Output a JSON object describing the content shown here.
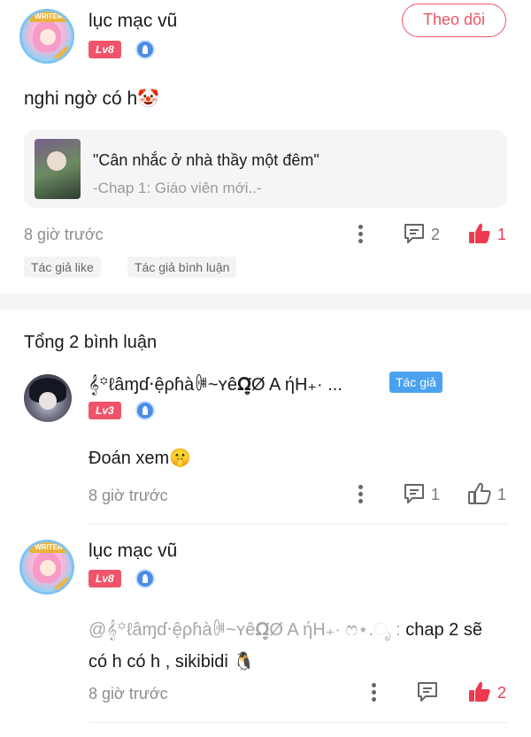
{
  "post": {
    "author": {
      "name": "lục mạc vũ",
      "level": "Lv8",
      "avatar_banner": "WRITER"
    },
    "follow_label": "Theo dõi",
    "text": "nghi ngờ có h",
    "text_emoji": "🤡",
    "reference": {
      "title": "\"Cân nhắc ở nhà thầy một đêm\"",
      "subtitle": "-Chap 1: Giáo viên mới..-"
    },
    "time": "8 giờ trước",
    "comment_count": "2",
    "like_count": "1",
    "tags": [
      "Tác giả like",
      "Tác giả bình luận"
    ],
    "colors": {
      "accent": "#ee3a50",
      "level_badge": "#f0546b",
      "author_tag": "#4aa2ee"
    }
  },
  "comments_header": {
    "total": "Tổng 2 bình luận"
  },
  "comments": [
    {
      "author": "𝄞꙳ℓâɱɗ‧ệρɦàꍲ~ʏê𝛀̤̥̣̈Ø A ήH₊· ...",
      "level": "Lv3",
      "author_tag": "Tác giả",
      "text": "Đoán xem",
      "text_emoji": "🤫",
      "time": "8 giờ trước",
      "comment_count": "1",
      "like_count": "1"
    },
    {
      "author": "lục mạc vũ",
      "level": "Lv8",
      "avatar_banner": "WRITER",
      "mention": "@𝄞꙳ℓâɱɗ‧ệρɦàꍲ~ʏê𝛀̤̥̣̈Ø A ήH₊· ෆ⋆.ೃ : ",
      "text": "chap 2 sẽ có h có h , sikibidi",
      "text_emoji": "🐧",
      "time": "8 giờ trước",
      "like_count": "2"
    }
  ]
}
